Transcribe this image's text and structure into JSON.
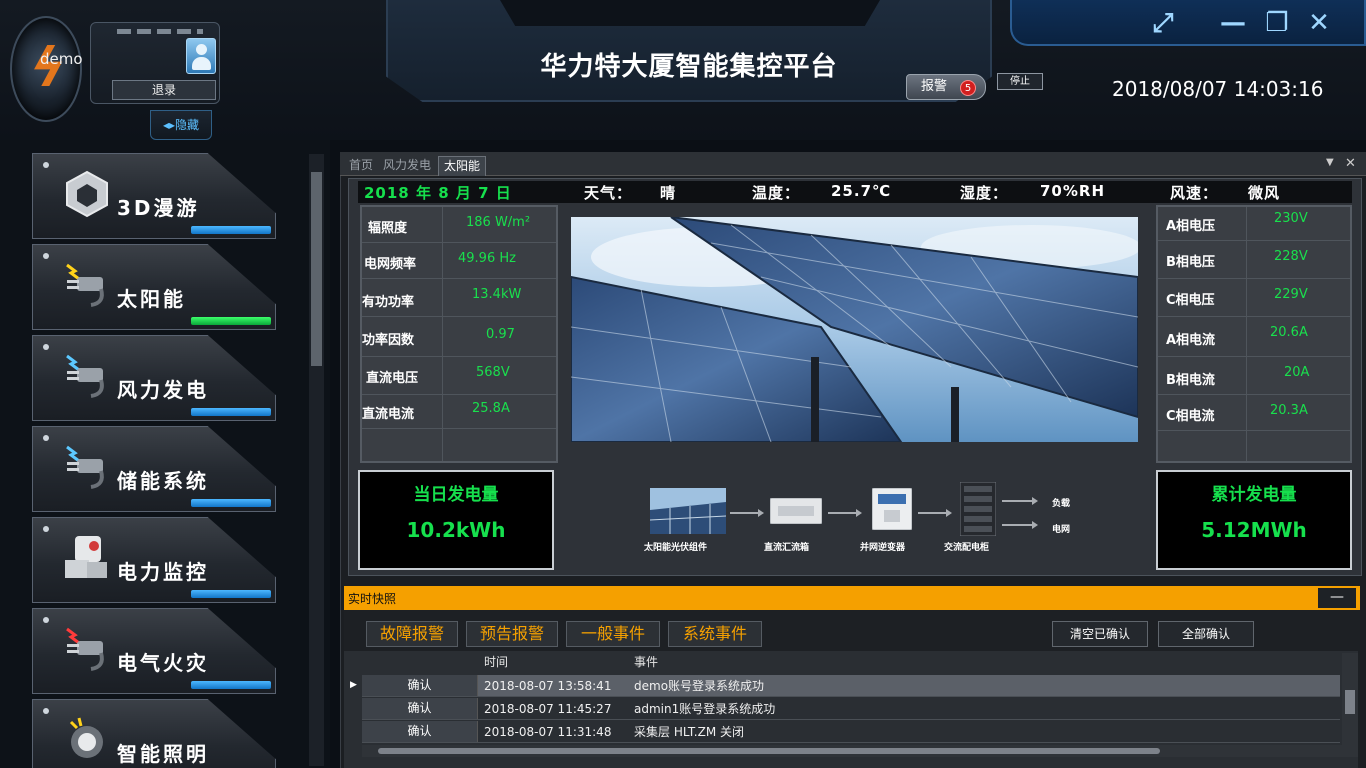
{
  "header": {
    "app_title": "华力特大厦智能集控平台",
    "user_name": "demo",
    "logout_label": "退录",
    "hide_label": "◂▸隐藏",
    "alarm_label": "报警",
    "alarm_count": "5",
    "stop_label": "停止",
    "datetime": "2018/08/07 14:03:16"
  },
  "sidebar": {
    "items": [
      {
        "label": "3D漫游",
        "icon": "unity-cube-icon",
        "active": false
      },
      {
        "label": "太阳能",
        "icon": "plug-lightning-icon",
        "active": true
      },
      {
        "label": "风力发电",
        "icon": "plug-lightning-icon",
        "active": false
      },
      {
        "label": "储能系统",
        "icon": "plug-lightning-icon",
        "active": false
      },
      {
        "label": "电力监控",
        "icon": "power-module-icon",
        "active": false
      },
      {
        "label": "电气火灾",
        "icon": "plug-fire-icon",
        "active": false
      },
      {
        "label": "智能照明",
        "icon": "lamp-icon",
        "active": false
      }
    ]
  },
  "tabs": [
    {
      "label": "首页",
      "active": false
    },
    {
      "label": "风力发电",
      "active": false
    },
    {
      "label": "太阳能",
      "active": true
    }
  ],
  "solar": {
    "date": "2018 年  8  月  7  日",
    "weather_label": "天气：",
    "weather_value": "晴",
    "temp_label": "温度：",
    "temp_value": "25.7℃",
    "humidity_label": "湿度：",
    "humidity_value": "70%RH",
    "wind_label": "风速：",
    "wind_value": "微风",
    "left_params": [
      {
        "label": "辐照度",
        "value": "186   W/m²"
      },
      {
        "label": "电网频率",
        "value": "49.96 Hz"
      },
      {
        "label": "有功功率",
        "value": "13.4kW"
      },
      {
        "label": "功率因数",
        "value": "0.97"
      },
      {
        "label": "直流电压",
        "value": "568V"
      },
      {
        "label": "直流电流",
        "value": "25.8A"
      }
    ],
    "right_params": [
      {
        "label": "A相电压",
        "value": "230V"
      },
      {
        "label": "B相电压",
        "value": "228V"
      },
      {
        "label": "C相电压",
        "value": "229V"
      },
      {
        "label": "A相电流",
        "value": "20.6A"
      },
      {
        "label": "B相电流",
        "value": "20A"
      },
      {
        "label": "C相电流",
        "value": "20.3A"
      }
    ],
    "daily_title": "当日发电量",
    "daily_value": "10.2kWh",
    "total_title": "累计发电量",
    "total_value": "5.12MWh",
    "flow": {
      "module": "太阳能光伏组件",
      "combiner": "直流汇流箱",
      "inverter": "并网逆变器",
      "cabinet": "交流配电柜",
      "load": "负载",
      "grid": "电网"
    }
  },
  "snapshot": {
    "title": "实时快照",
    "minimize": "—",
    "filters": [
      "故障报警",
      "预告报警",
      "一般事件",
      "系统事件"
    ],
    "clear_confirmed": "清空已确认",
    "confirm_all": "全部确认",
    "columns": {
      "time": "时间",
      "event": "事件"
    },
    "rows": [
      {
        "action": "确认",
        "time": "2018-08-07 13:58:41",
        "event": "demo账号登录系统成功"
      },
      {
        "action": "确认",
        "time": "2018-08-07 11:45:27",
        "event": "admin1账号登录系统成功"
      },
      {
        "action": "确认",
        "time": "2018-08-07 11:31:48",
        "event": "采集层 HLT.ZM 关闭"
      }
    ]
  },
  "colors": {
    "accent_green": "#16e04d",
    "accent_orange": "#f5a000",
    "alarm_red": "#d21f1f",
    "nav_blue": "#4cb7ff"
  }
}
